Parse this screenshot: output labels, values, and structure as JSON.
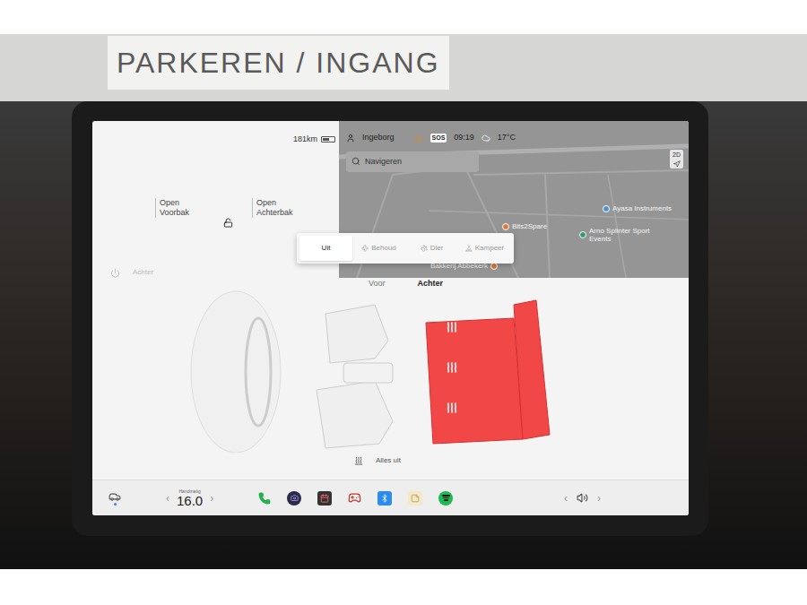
{
  "sign": "PARKEREN / INGANG",
  "status_bar": {
    "range": "181km",
    "battery_level": 0.55,
    "user": "Ingeborg",
    "sos": "SOS",
    "time": "09:19",
    "temperature": "17°C"
  },
  "search": {
    "placeholder": "Navigeren"
  },
  "map": {
    "view": "2D",
    "places": [
      {
        "name": "Ayasa Instruments",
        "color": "#4a8fd6"
      },
      {
        "name": "Bits2Spare",
        "color": "#e0783a"
      },
      {
        "name": "Arno Splinter Sport Events",
        "color": "#2f9e6a"
      },
      {
        "name": "Bakkerij Abbekerk",
        "color": "#e0783a"
      }
    ]
  },
  "trunks": [
    {
      "action": "Open",
      "name": "Voorbak"
    },
    {
      "action": "Open",
      "name": "Achterbak"
    }
  ],
  "climate_modes": [
    {
      "label": "Uit",
      "selected": true
    },
    {
      "label": "Behoud",
      "selected": false
    },
    {
      "label": "Dier",
      "selected": false
    },
    {
      "label": "Kampeer",
      "selected": false
    }
  ],
  "rear_power": {
    "label": "Achter",
    "on": false
  },
  "seat_views": [
    {
      "label": "Voor",
      "selected": false
    },
    {
      "label": "Achter",
      "selected": true
    }
  ],
  "seats": [
    {
      "row": "front",
      "heated": false,
      "heat_level": 0
    },
    {
      "row": "rear",
      "heated": true,
      "heat_level": 3
    }
  ],
  "all_off": {
    "label": "Alles uit"
  },
  "bottom_bar": {
    "temp_mode": "Handmatig",
    "temperature": "16.0",
    "left_arrow": "‹",
    "right_arrow": "›",
    "volume_left": "‹",
    "volume_right": "›"
  }
}
